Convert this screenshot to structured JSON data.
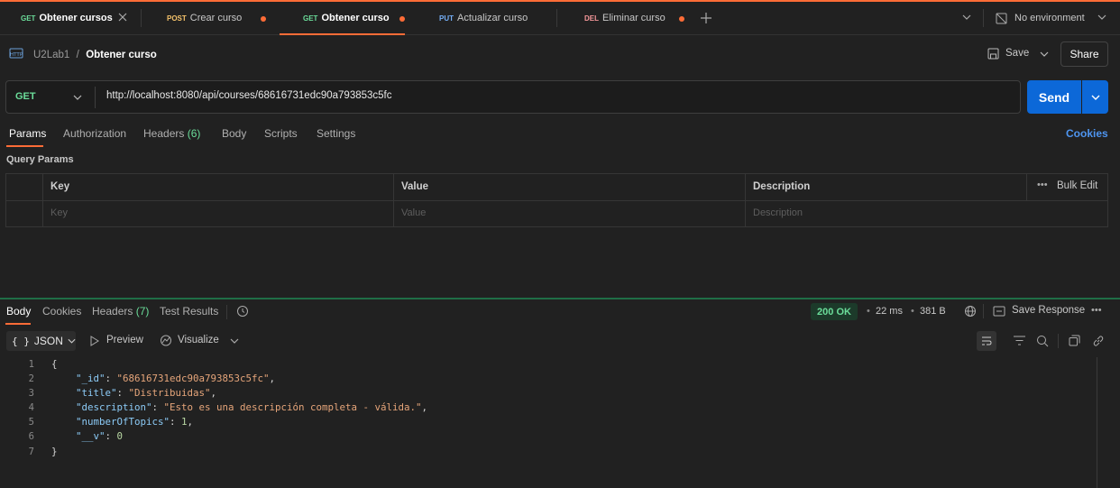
{
  "tabs": [
    {
      "method": "GET",
      "label": "Obtener cursos"
    },
    {
      "method": "POST",
      "label": "Crear curso"
    },
    {
      "method": "GET",
      "label": "Obtener curso"
    },
    {
      "method": "PUT",
      "label": "Actualizar curso"
    },
    {
      "method": "DEL",
      "label": "Eliminar curso"
    }
  ],
  "environment": "No environment",
  "breadcrumb": {
    "collection": "U2Lab1",
    "separator": "/",
    "request": "Obtener curso"
  },
  "actions": {
    "save": "Save",
    "share": "Share"
  },
  "request": {
    "method": "GET",
    "url": "http://localhost:8080/api/courses/68616731edc90a793853c5fc",
    "send": "Send"
  },
  "request_tabs": {
    "params": "Params",
    "authorization": "Authorization",
    "headers": "Headers",
    "headers_count": "(6)",
    "body": "Body",
    "scripts": "Scripts",
    "settings": "Settings",
    "cookies": "Cookies"
  },
  "query_params": {
    "title": "Query Params",
    "columns": {
      "key": "Key",
      "value": "Value",
      "description": "Description"
    },
    "bulk_edit": "Bulk Edit",
    "placeholders": {
      "key": "Key",
      "value": "Value",
      "description": "Description"
    }
  },
  "response": {
    "tabs": {
      "body": "Body",
      "cookies": "Cookies",
      "headers": "Headers",
      "headers_count": "(7)",
      "test_results": "Test Results"
    },
    "status": "200 OK",
    "time": "22 ms",
    "size": "381 B",
    "save_response": "Save Response",
    "format": "JSON",
    "preview": "Preview",
    "visualize": "Visualize",
    "line_numbers": [
      "1",
      "2",
      "3",
      "4",
      "5",
      "6",
      "7"
    ],
    "json": {
      "open": "{",
      "close": "}",
      "fields": [
        {
          "key": "\"_id\"",
          "value": "\"68616731edc90a793853c5fc\"",
          "type": "string",
          "comma": ","
        },
        {
          "key": "\"title\"",
          "value": "\"Distribuidas\"",
          "type": "string",
          "comma": ","
        },
        {
          "key": "\"description\"",
          "value": "\"Esto es una descripción completa - válida.\"",
          "type": "string",
          "comma": ","
        },
        {
          "key": "\"numberOfTopics\"",
          "value": "1",
          "type": "number",
          "comma": ","
        },
        {
          "key": "\"__v\"",
          "value": "0",
          "type": "number",
          "comma": ""
        }
      ]
    }
  },
  "colors": {
    "accent": "#ff6c37",
    "send": "#0c68d8",
    "status_ok": "#6bdd9a"
  }
}
